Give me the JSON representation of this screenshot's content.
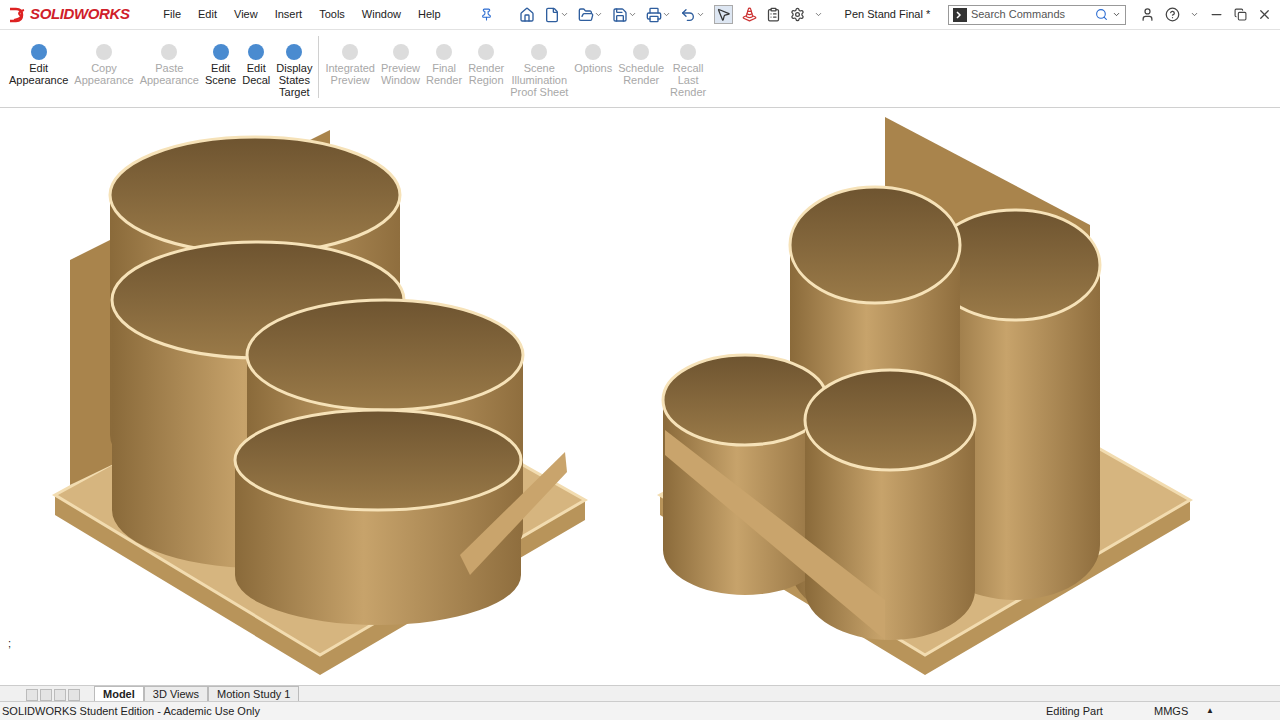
{
  "app": {
    "logo": "SOLIDWORKS",
    "document_title": "Pen Stand Final *"
  },
  "menu": [
    "File",
    "Edit",
    "View",
    "Insert",
    "Tools",
    "Window",
    "Help"
  ],
  "search": {
    "placeholder": "Search Commands"
  },
  "ribbon": [
    {
      "lines": [
        "Edit",
        "Appearance"
      ],
      "disabled": false,
      "group": 1
    },
    {
      "lines": [
        "Copy",
        "Appearance"
      ],
      "disabled": true,
      "group": 1
    },
    {
      "lines": [
        "Paste",
        "Appearance"
      ],
      "disabled": true,
      "group": 1
    },
    {
      "lines": [
        "Edit",
        "Scene"
      ],
      "disabled": false,
      "group": 1
    },
    {
      "lines": [
        "Edit",
        "Decal"
      ],
      "disabled": false,
      "group": 1
    },
    {
      "lines": [
        "Display",
        "States",
        "Target"
      ],
      "disabled": false,
      "group": 1
    },
    {
      "lines": [
        "Integrated",
        "Preview"
      ],
      "disabled": true,
      "group": 2
    },
    {
      "lines": [
        "Preview",
        "Window"
      ],
      "disabled": true,
      "group": 2
    },
    {
      "lines": [
        "Final",
        "Render"
      ],
      "disabled": true,
      "group": 2
    },
    {
      "lines": [
        "Render",
        "Region"
      ],
      "disabled": true,
      "group": 2
    },
    {
      "lines": [
        "Scene",
        "Illumination",
        "Proof Sheet"
      ],
      "disabled": true,
      "group": 2
    },
    {
      "lines": [
        "Options"
      ],
      "disabled": true,
      "group": 2
    },
    {
      "lines": [
        "Schedule",
        "Render"
      ],
      "disabled": true,
      "group": 2
    },
    {
      "lines": [
        "Recall",
        "Last",
        "Render"
      ],
      "disabled": true,
      "group": 2
    }
  ],
  "viewport": {
    "mark": ";"
  },
  "tabs": [
    {
      "label": "Model",
      "selected": true
    },
    {
      "label": "3D Views",
      "selected": false
    },
    {
      "label": "Motion Study 1",
      "selected": false
    }
  ],
  "status_bar": {
    "left": "SOLIDWORKS Student Edition - Academic Use Only",
    "mode": "Editing Part",
    "units": "MMGS",
    "units_arrow": "▲"
  }
}
